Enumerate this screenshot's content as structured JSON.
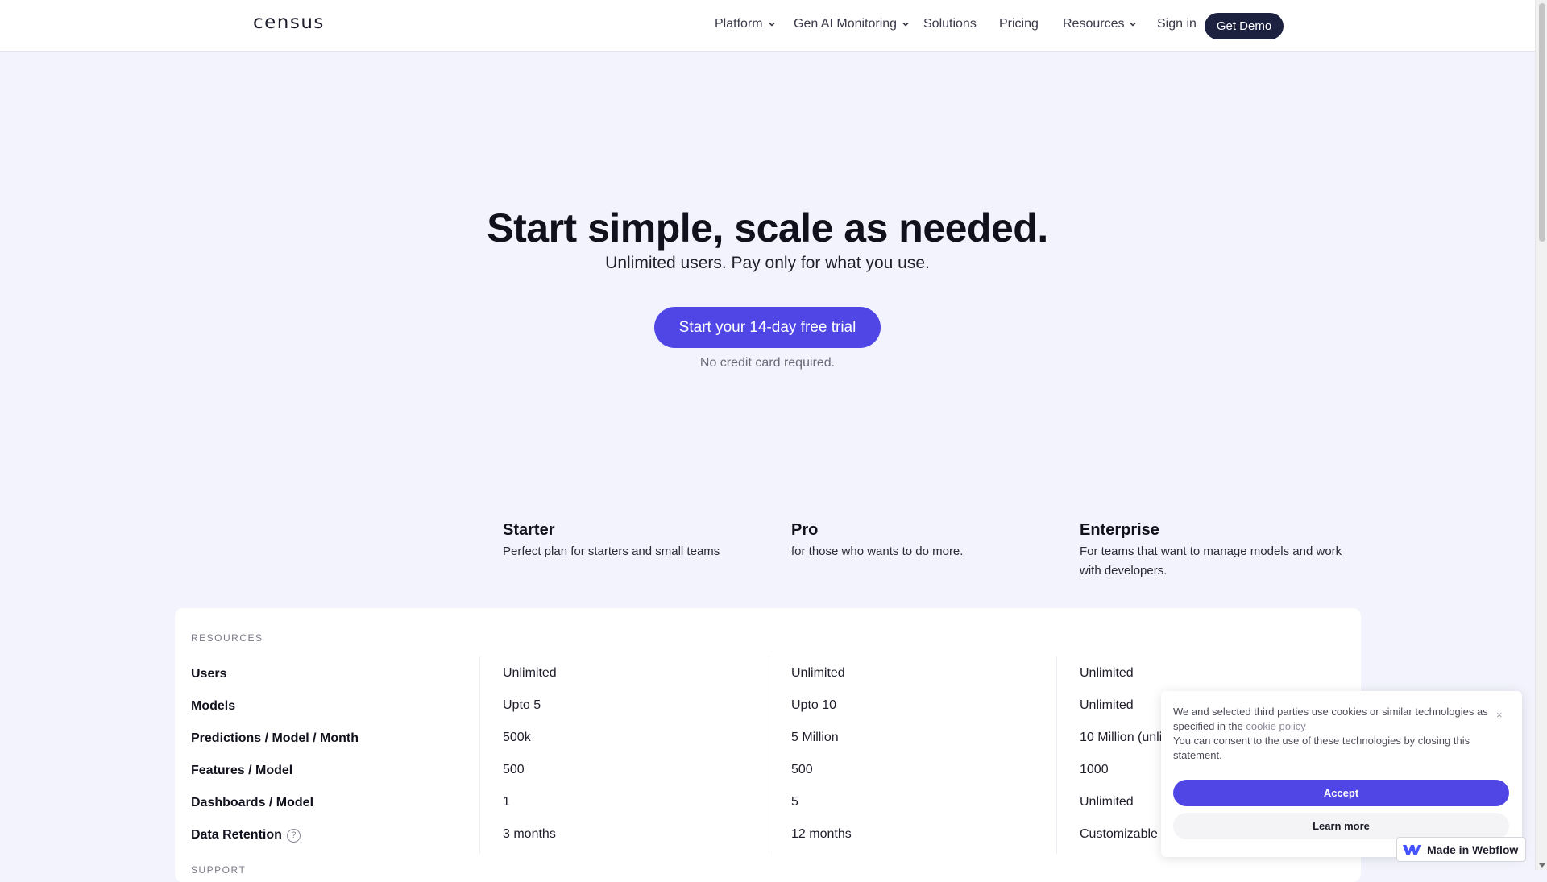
{
  "header": {
    "logo": "census",
    "nav": [
      {
        "label": "Platform",
        "dropdown": true
      },
      {
        "label": "Gen AI Monitoring",
        "dropdown": true
      },
      {
        "label": "Solutions",
        "dropdown": false
      },
      {
        "label": "Pricing",
        "dropdown": false
      },
      {
        "label": "Resources",
        "dropdown": true
      }
    ],
    "signin": "Sign in",
    "demo": "Get Demo"
  },
  "hero": {
    "title": "Start simple, scale as needed.",
    "subtitle": "Unlimited users. Pay only for what you use.",
    "cta": "Start your 14-day free trial",
    "note": "No credit card required."
  },
  "plans": [
    {
      "name": "Starter",
      "desc": "Perfect plan for starters and small teams"
    },
    {
      "name": "Pro",
      "desc": "for those who wants to do more."
    },
    {
      "name": "Enterprise",
      "desc": "For teams that want to manage models and work with developers."
    }
  ],
  "table": {
    "section1": "RESOURCES",
    "section2": "SUPPORT",
    "rows": [
      {
        "label": "Users",
        "values": [
          "Unlimited",
          "Unlimited",
          "Unlimited"
        ]
      },
      {
        "label": "Models",
        "values": [
          "Upto 5",
          "Upto 10",
          "Unlimited"
        ]
      },
      {
        "label": "Predictions / Model / Month",
        "values": [
          "500k",
          "5 Million",
          "10 Million (unli"
        ]
      },
      {
        "label": "Features / Model",
        "values": [
          "500",
          "500",
          "1000"
        ]
      },
      {
        "label": "Dashboards / Model",
        "values": [
          "1",
          "5",
          "Unlimited"
        ]
      },
      {
        "label": "Data Retention",
        "values": [
          "3 months",
          "12 months",
          "Customizable"
        ],
        "help": true
      }
    ]
  },
  "cookie": {
    "text_before": "We and selected third parties use cookies or similar technologies as specified in the ",
    "link": "cookie policy",
    "text_after": "You can consent to the use of these technologies by closing this statement.",
    "close": "×",
    "accept": "Accept",
    "learn": "Learn more"
  },
  "webflow_badge": "Made in Webflow",
  "colors": {
    "accent": "#4f46e5",
    "dark_button": "#1d2140",
    "page_bg": "#f2f3fc"
  }
}
